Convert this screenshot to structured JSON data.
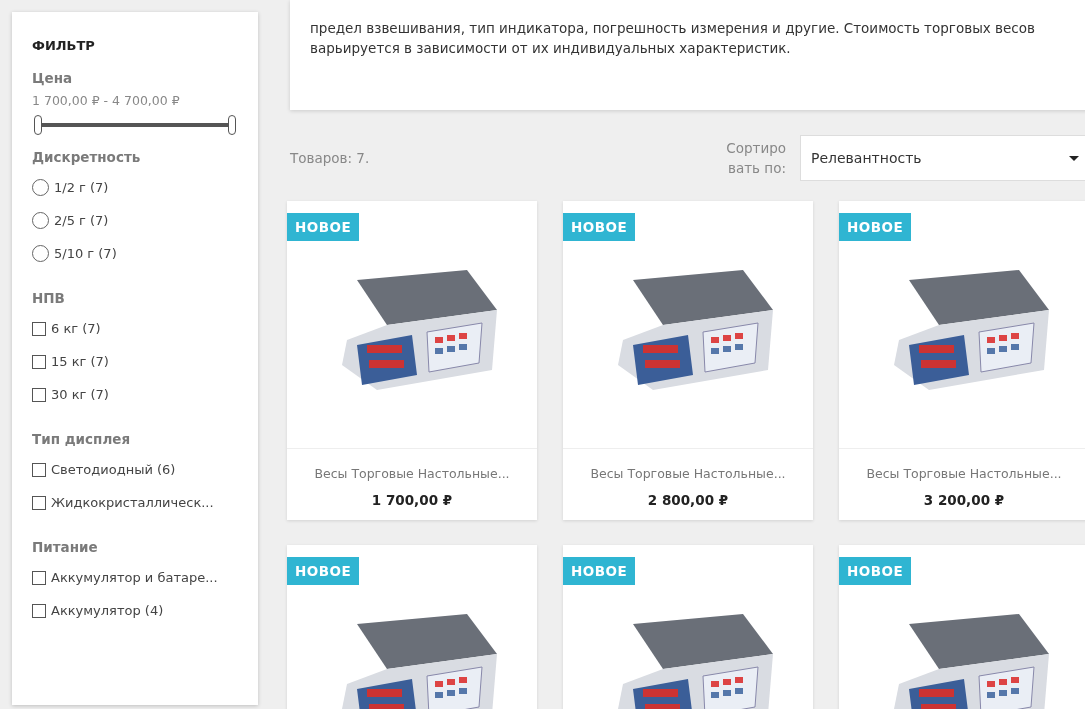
{
  "filter": {
    "title": "ФИЛЬТР",
    "price": {
      "label": "Цена",
      "range": "1 700,00 ₽ - 4 700,00 ₽",
      "thumbs": [
        {
          "level": 0
        },
        {
          "level": 1
        }
      ]
    },
    "groups": [
      {
        "title": "Дискретность",
        "kind": "radio",
        "options": [
          {
            "label": "1/2 г (7)",
            "selected": false
          },
          {
            "label": "2/5 г (7)",
            "selected": false
          },
          {
            "label": "5/10 г (7)",
            "selected": false
          }
        ]
      },
      {
        "title": "НПВ",
        "kind": "checkbox",
        "options": [
          {
            "label": "6 кг (7)",
            "checked": false
          },
          {
            "label": "15 кг (7)",
            "checked": false
          },
          {
            "label": "30 кг (7)",
            "checked": false
          }
        ]
      },
      {
        "title": "Тип дисплея",
        "kind": "checkbox",
        "options": [
          {
            "label": "Светодиодный (6)",
            "checked": false
          },
          {
            "label": "Жидкокристаллическ...",
            "checked": false
          }
        ]
      },
      {
        "title": "Питание",
        "kind": "checkbox",
        "options": [
          {
            "label": "Аккумулятор и батаре...",
            "checked": false
          },
          {
            "label": "Аккумулятор (4)",
            "checked": false
          }
        ]
      }
    ]
  },
  "description": "предел взвешивания, тип индикатора, погрешность измерения и другие. Стоимость торговых весов варьируется в зависимости от их индивидуальных характеристик.",
  "count": "Товаров: 7.",
  "sort": {
    "label_lines": [
      "Сортиро",
      "вать по:"
    ],
    "value": "Релевантность"
  },
  "products": [
    {
      "badge": "НОВОЕ",
      "name": "Весы Торговые Настольные...",
      "price": "1 700,00 ₽"
    },
    {
      "badge": "НОВОЕ",
      "name": "Весы Торговые Настольные...",
      "price": "2 800,00 ₽"
    },
    {
      "badge": "НОВОЕ",
      "name": "Весы Торговые Настольные...",
      "price": "3 200,00 ₽"
    },
    {
      "badge": "НОВОЕ"
    },
    {
      "badge": "НОВОЕ"
    },
    {
      "badge": "НОВОЕ"
    }
  ]
}
